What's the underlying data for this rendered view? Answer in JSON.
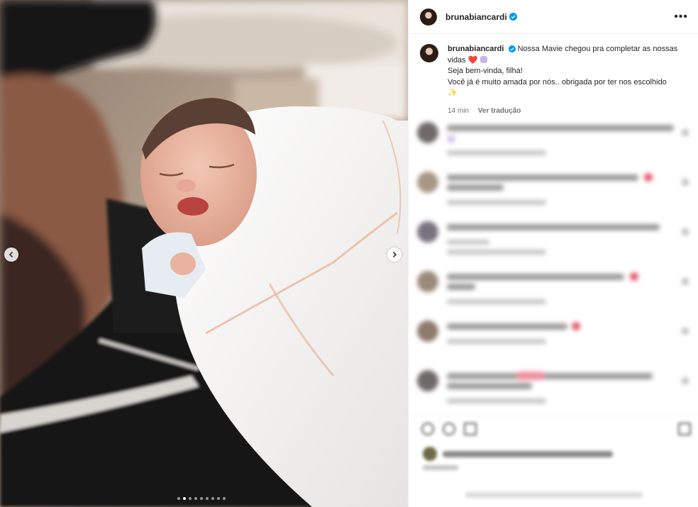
{
  "post": {
    "username": "brunabiancardi",
    "caption_line1": "Nossa Mavie chegou pra completar as nossas vidas",
    "caption_emoji1": "❤️",
    "caption_line2": "Seja bem-vinda, filha!",
    "caption_line3": "Você já é muito amada por nós.. obrigada por ter nos escolhido",
    "caption_emoji3": "✨",
    "timestamp": "14 min",
    "see_translation": "Ver tradução"
  },
  "carousel": {
    "total_slides": 9,
    "active_index": 1
  },
  "icons": {
    "verified": "verified-badge-icon",
    "more": "more-options-icon",
    "prev": "chevron-left-icon",
    "next": "chevron-right-icon"
  },
  "colors": {
    "verified_blue": "#0095f6",
    "text": "#262626",
    "secondary_text": "#737373"
  }
}
